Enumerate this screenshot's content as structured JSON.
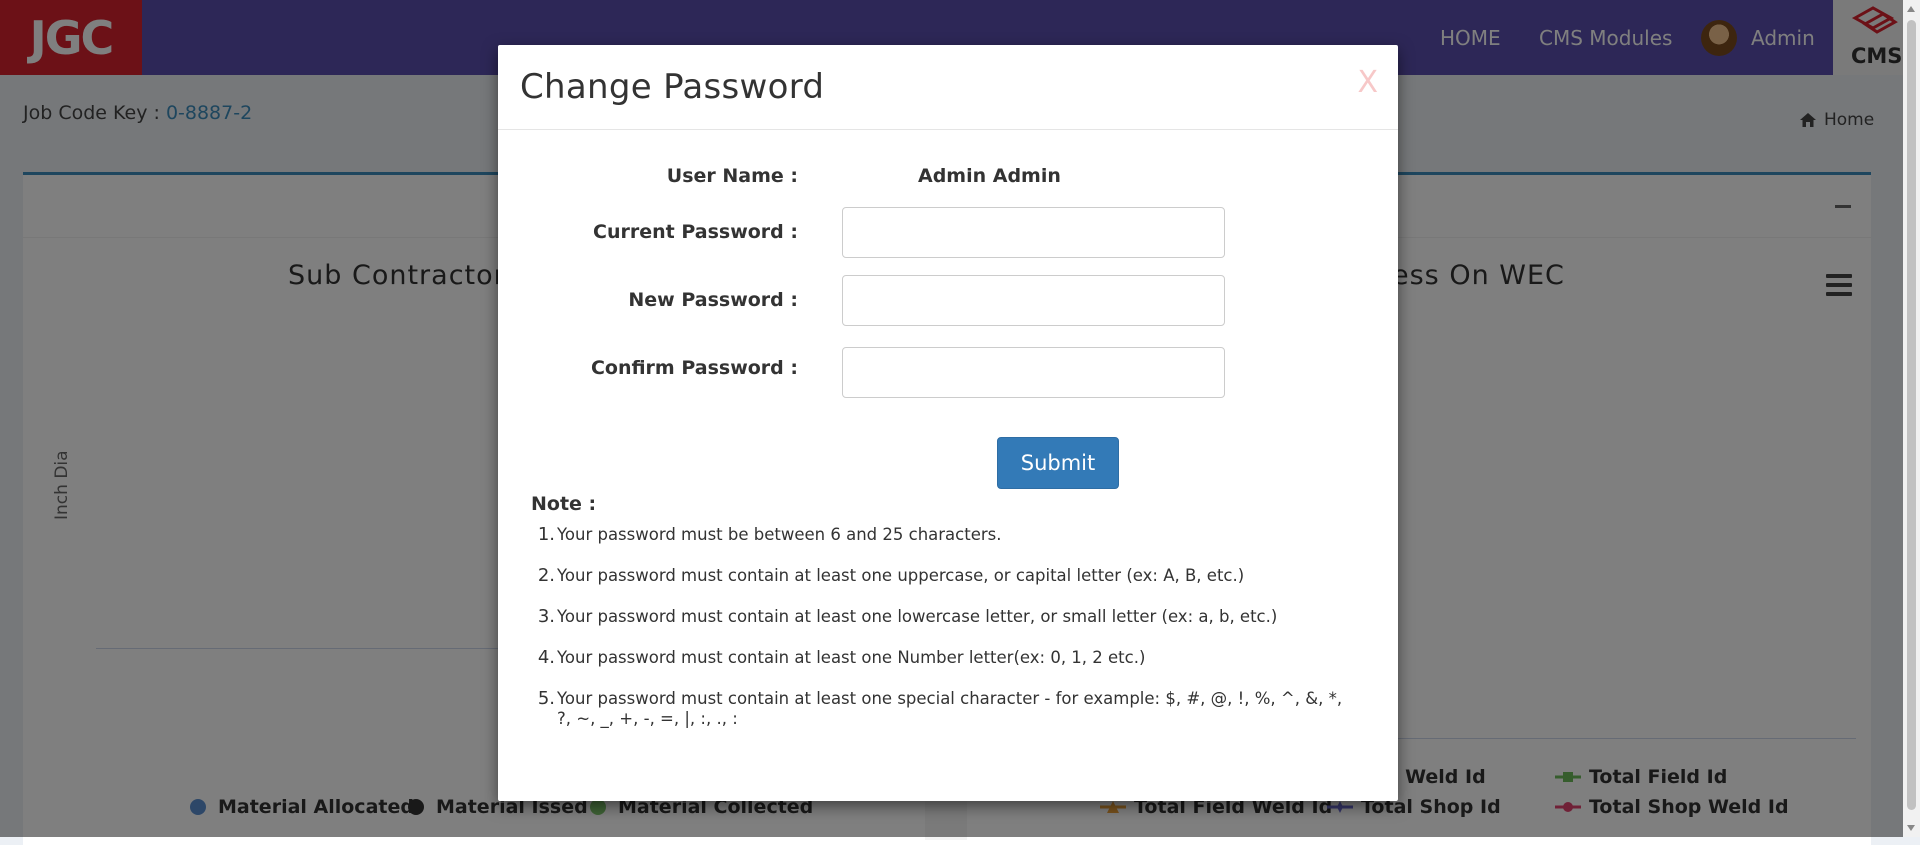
{
  "header": {
    "logo_text": "JGC",
    "nav_home": "HOME",
    "nav_cms_modules": "CMS Modules",
    "user_name": "Admin",
    "cms_label": "CMS"
  },
  "page": {
    "job_code_label": "Job Code Key : ",
    "job_code_value": "0-8887-2",
    "breadcrumb_home": "Home"
  },
  "charts": {
    "left_title": "Sub Contractor v",
    "right_title": "ess On WEC",
    "y_axis_label": "Inch Dia",
    "left_legend": [
      "Material Allocated",
      "Material Issed",
      "Material Collected"
    ],
    "right_legend": [
      "l Weld Id",
      "Total Field Id",
      "Total Field Weld Id",
      "Total Shop Id",
      "Total Shop Weld Id"
    ],
    "colors": {
      "material_allocated": "#5b8fd0",
      "material_issed": "#333333",
      "material_collected": "#7cc46a",
      "total_field_id": "#6dbb5b",
      "total_field_weld_id": "#f0a23a",
      "total_shop_id": "#6b6bd0",
      "total_shop_weld_id": "#e0436f"
    }
  },
  "modal": {
    "title": "Change Password",
    "close_label": "X",
    "user_name_label": "User Name :",
    "user_name_value": "Admin Admin",
    "current_password_label": "Current Password :",
    "new_password_label": "New Password :",
    "confirm_password_label": "Confirm Password :",
    "current_password_value": "",
    "new_password_value": "",
    "confirm_password_value": "",
    "submit_label": "Submit",
    "note_label": "Note :",
    "notes": [
      {
        "num": "1.",
        "text": "Your password must be between 6 and 25 characters."
      },
      {
        "num": "2.",
        "text": "Your password must contain at least one uppercase, or capital letter (ex: A, B, etc.)"
      },
      {
        "num": "3.",
        "text": "Your password must contain at least one lowercase letter, or small letter (ex: a, b, etc.)"
      },
      {
        "num": "4.",
        "text": "Your password must contain at least one Number letter(ex: 0, 1, 2 etc.)"
      },
      {
        "num": "5.",
        "text": "Your password must contain at least one special character - for example: $, #, @, !, %, ^, &, *, ?, ~, _, +, -, =, |, :, ., :"
      }
    ]
  }
}
